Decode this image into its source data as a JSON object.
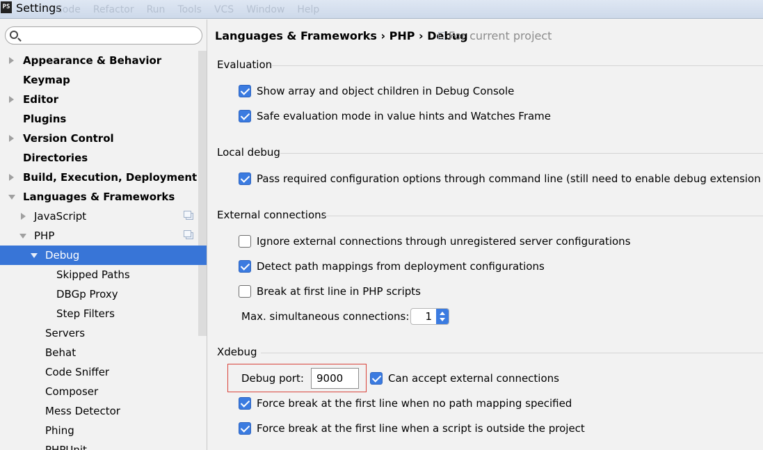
{
  "window": {
    "title": "Settings",
    "app_icon": "PS",
    "ghost_menu": [
      "Code",
      "Refactor",
      "Run",
      "Tools",
      "VCS",
      "Window",
      "Help"
    ]
  },
  "search": {
    "placeholder": "",
    "value": ""
  },
  "sidebar": {
    "items": [
      {
        "label": "Appearance & Behavior",
        "arrow": "right",
        "bold": true
      },
      {
        "label": "Keymap",
        "arrow": "none",
        "bold": true
      },
      {
        "label": "Editor",
        "arrow": "right",
        "bold": true
      },
      {
        "label": "Plugins",
        "arrow": "none",
        "bold": true
      },
      {
        "label": "Version Control",
        "arrow": "right",
        "bold": true
      },
      {
        "label": "Directories",
        "arrow": "none",
        "bold": true
      },
      {
        "label": "Build, Execution, Deployment",
        "arrow": "right",
        "bold": true
      },
      {
        "label": "Languages & Frameworks",
        "arrow": "down",
        "bold": true
      },
      {
        "label": "JavaScript",
        "arrow": "right",
        "bold": false,
        "project_icon": true
      },
      {
        "label": "PHP",
        "arrow": "down",
        "bold": false,
        "project_icon": true
      },
      {
        "label": "Debug",
        "arrow": "down",
        "bold": false,
        "selected": true
      },
      {
        "label": "Skipped Paths",
        "arrow": "none",
        "bold": false
      },
      {
        "label": "DBGp Proxy",
        "arrow": "none",
        "bold": false
      },
      {
        "label": "Step Filters",
        "arrow": "none",
        "bold": false
      },
      {
        "label": "Servers",
        "arrow": "none",
        "bold": false
      },
      {
        "label": "Behat",
        "arrow": "none",
        "bold": false
      },
      {
        "label": "Code Sniffer",
        "arrow": "none",
        "bold": false
      },
      {
        "label": "Composer",
        "arrow": "none",
        "bold": false
      },
      {
        "label": "Mess Detector",
        "arrow": "none",
        "bold": false
      },
      {
        "label": "Phing",
        "arrow": "none",
        "bold": false
      },
      {
        "label": "PHPUnit",
        "arrow": "none",
        "bold": false
      }
    ]
  },
  "breadcrumb": {
    "text": "Languages & Frameworks › PHP › Debug",
    "scope": "For current project"
  },
  "sections": {
    "evaluation": {
      "title": "Evaluation",
      "options": [
        {
          "label": "Show array and object children in Debug Console",
          "checked": true
        },
        {
          "label": "Safe evaluation mode in value hints and Watches Frame",
          "checked": true
        }
      ]
    },
    "local_debug": {
      "title": "Local debug",
      "options": [
        {
          "label": "Pass required configuration options through command line (still need to enable debug extension ma",
          "checked": true
        }
      ]
    },
    "external": {
      "title": "External connections",
      "options": [
        {
          "label": "Ignore external connections through unregistered server configurations",
          "checked": false
        },
        {
          "label": "Detect path mappings from deployment configurations",
          "checked": true
        },
        {
          "label": "Break at first line in PHP scripts",
          "checked": false
        }
      ],
      "max_connections_label": "Max. simultaneous connections:",
      "max_connections_value": "1"
    },
    "xdebug": {
      "title": "Xdebug",
      "port_label": "Debug port:",
      "port_value": "9000",
      "options": [
        {
          "label": "Can accept external connections",
          "checked": true
        },
        {
          "label": "Force break at the first line when no path mapping specified",
          "checked": true
        },
        {
          "label": "Force break at the first line when a script is outside the project",
          "checked": true
        }
      ]
    }
  },
  "colors": {
    "selection": "#3875d7",
    "checkbox": "#3b7be0",
    "highlight_border": "#d9433a"
  }
}
